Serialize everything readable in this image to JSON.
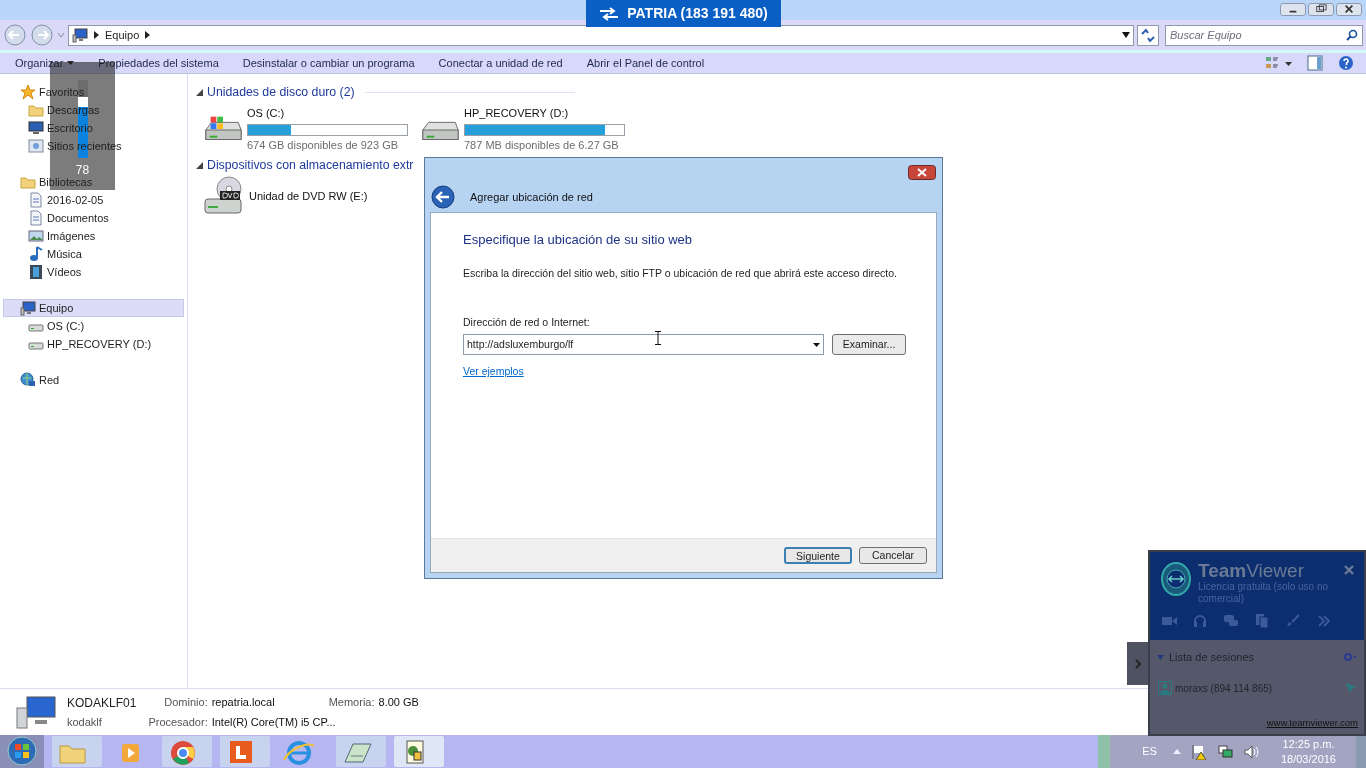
{
  "remote_banner": {
    "title": "PATRIA (183 191 480)"
  },
  "address_bar": {
    "path": [
      "Equipo"
    ],
    "search_placeholder": "Buscar Equipo"
  },
  "toolbar": {
    "items": [
      {
        "label": "Organizar",
        "kind": "menu"
      },
      {
        "label": "Propiedades del sistema",
        "kind": "plain"
      },
      {
        "label": "Desinstalar o cambiar un programa",
        "kind": "plain"
      },
      {
        "label": "Conectar a unidad de red",
        "kind": "plain"
      },
      {
        "label": "Abrir el Panel de control",
        "kind": "plain"
      }
    ]
  },
  "sidebar": {
    "groups": [
      {
        "label": "Favoritos",
        "kind": "star",
        "selected": false,
        "children": [
          {
            "label": "Descargas",
            "kind": "folder"
          },
          {
            "label": "Escritorio",
            "kind": "monitor"
          },
          {
            "label": "Sitios recientes",
            "kind": "recent"
          }
        ]
      },
      {
        "label": "Bibliotecas",
        "kind": "folder",
        "selected": false,
        "children": [
          {
            "label": "2016-02-05",
            "kind": "document"
          },
          {
            "label": "Documentos",
            "kind": "document"
          },
          {
            "label": "Imágenes",
            "kind": "image"
          },
          {
            "label": "Música",
            "kind": "music"
          },
          {
            "label": "Vídeos",
            "kind": "video"
          }
        ]
      },
      {
        "label": "Equipo",
        "kind": "computer",
        "selected": true,
        "children": [
          {
            "label": "OS (C:)",
            "kind": "drive"
          },
          {
            "label": "HP_RECOVERY (D:)",
            "kind": "drive"
          }
        ]
      },
      {
        "label": "Red",
        "kind": "network",
        "selected": false
      }
    ]
  },
  "content": {
    "sections": [
      {
        "title": "Unidades de disco duro (2)",
        "items": [
          {
            "name": "OS (C:)",
            "kind": "system_drive",
            "level": 0.27,
            "reading": "674 GB disponibles de 923 GB"
          },
          {
            "name": "HP_RECOVERY (D:)",
            "kind": "drive",
            "level": 0.88,
            "reading": "787 MB disponibles de 6.27 GB"
          }
        ]
      },
      {
        "title": "Dispositivos con almacenamiento extr",
        "items": [
          {
            "name": "Unidad de DVD RW (E:)",
            "kind": "dvd"
          }
        ]
      }
    ]
  },
  "details": {
    "computer": "KODAKLF01",
    "user": "kodaklf",
    "fields": [
      {
        "label": "Dominio:",
        "value": "repatria.local"
      },
      {
        "label": "Memoria:",
        "value": "8.00 GB"
      },
      {
        "label": "Procesador:",
        "value": "Intel(R) Core(TM) i5 CP..."
      }
    ]
  },
  "dialog": {
    "title": "Agregar ubicación de red",
    "heading": "Especifique la ubicación de su sitio web",
    "description": "Escriba la dirección del sitio web, sitio FTP o ubicación de red que abrirá este acceso directo.",
    "field_label": "Dirección de red o Internet:",
    "field_value": "http://adsluxemburgo/lf",
    "browse_button": "Examinar...",
    "link": "Ver ejemplos",
    "buttons": [
      {
        "label": "Siguiente",
        "selected": true
      },
      {
        "label": "Cancelar",
        "selected": false
      }
    ]
  },
  "volume_osd": {
    "level": 0.78,
    "reading": "78"
  },
  "teamviewer": {
    "brand_bold": "Team",
    "brand_light": "Viewer",
    "license": "Licencia gratuita (solo uso no comercial)",
    "sessions_title": "Lista de sesiones",
    "sessions": [
      "moraxs (894 114 865)"
    ],
    "link": "www.teamviewer.com"
  },
  "taskbar": {
    "language": "ES",
    "time": "12:25 p.m.",
    "date": "18/03/2016"
  }
}
